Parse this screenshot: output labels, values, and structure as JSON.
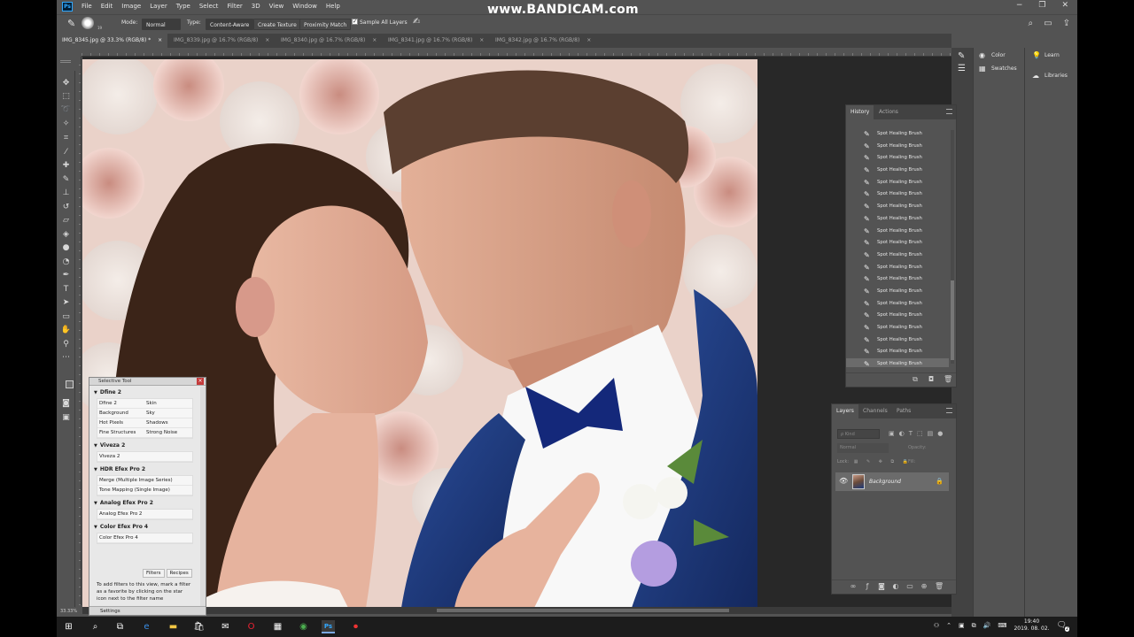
{
  "app": {
    "logo": "Ps",
    "menus": [
      "File",
      "Edit",
      "Image",
      "Layer",
      "Type",
      "Select",
      "Filter",
      "3D",
      "View",
      "Window",
      "Help"
    ],
    "watermark": "www.BANDICAM.com",
    "window_controls": [
      "−",
      "❐",
      "✕"
    ]
  },
  "options": {
    "mode_label": "Mode:",
    "mode_value": "Normal",
    "type_label": "Type:",
    "type_buttons": [
      "Content-Aware",
      "Create Texture",
      "Proximity Match"
    ],
    "sample_all_layers": "Sample All Layers",
    "brush_size": "19"
  },
  "tabs": [
    "IMG_8345.jpg @ 33.3% (RGB/8) *",
    "IMG_8339.jpg @ 16.7% (RGB/8)",
    "IMG_8340.jpg @ 16.7% (RGB/8)",
    "IMG_8341.jpg @ 16.7% (RGB/8)",
    "IMG_8342.jpg @ 16.7% (RGB/8)"
  ],
  "status": {
    "zoom": "33.33%"
  },
  "selective_tool": {
    "title": "Selective Tool",
    "sections": [
      {
        "title": "Dfine 2",
        "rows": [
          [
            "Dfine 2",
            "Skin"
          ],
          [
            "Background",
            "Sky"
          ],
          [
            "Hot Pixels",
            "Shadows"
          ],
          [
            "Fine Structures",
            "Strong Noise"
          ]
        ]
      },
      {
        "title": "Viveza 2",
        "rows": [
          [
            "Viveza 2",
            ""
          ]
        ]
      },
      {
        "title": "HDR Efex Pro 2",
        "rows": [
          [
            "Merge (Multiple Image Series)",
            ""
          ],
          [
            "Tone Mapping (Single Image)",
            ""
          ]
        ]
      },
      {
        "title": "Analog Efex Pro 2",
        "rows": [
          [
            "Analog Efex Pro 2",
            ""
          ]
        ]
      },
      {
        "title": "Color Efex Pro 4",
        "rows": [
          [
            "Color Efex Pro 4",
            ""
          ]
        ]
      }
    ],
    "tabs": [
      "Filters",
      "Recipes"
    ],
    "help_text": "To add filters to this view, mark a filter as a favorite by clicking on the star icon next to the filter name",
    "settings": "Settings"
  },
  "dock": {
    "col1": [
      "Color",
      "Swatches"
    ],
    "col2": [
      "Learn",
      "Libraries"
    ]
  },
  "history": {
    "tabs": [
      "History",
      "Actions"
    ],
    "items": [
      "Spot Healing Brush",
      "Spot Healing Brush",
      "Spot Healing Brush",
      "Spot Healing Brush",
      "Spot Healing Brush",
      "Spot Healing Brush",
      "Spot Healing Brush",
      "Spot Healing Brush",
      "Spot Healing Brush",
      "Spot Healing Brush",
      "Spot Healing Brush",
      "Spot Healing Brush",
      "Spot Healing Brush",
      "Spot Healing Brush",
      "Spot Healing Brush",
      "Spot Healing Brush",
      "Spot Healing Brush",
      "Spot Healing Brush",
      "Spot Healing Brush",
      "Spot Healing Brush"
    ]
  },
  "layers": {
    "tabs": [
      "Layers",
      "Channels",
      "Paths"
    ],
    "search_placeholder": "ρ Kind",
    "blend_mode": "Normal",
    "opacity_label": "Opacity:",
    "lock_label": "Lock:",
    "fill_label": "Fill:",
    "layer_name": "Background"
  },
  "taskbar": {
    "time": "19:40",
    "date": "2019. 08. 02.",
    "notifications": "2"
  }
}
